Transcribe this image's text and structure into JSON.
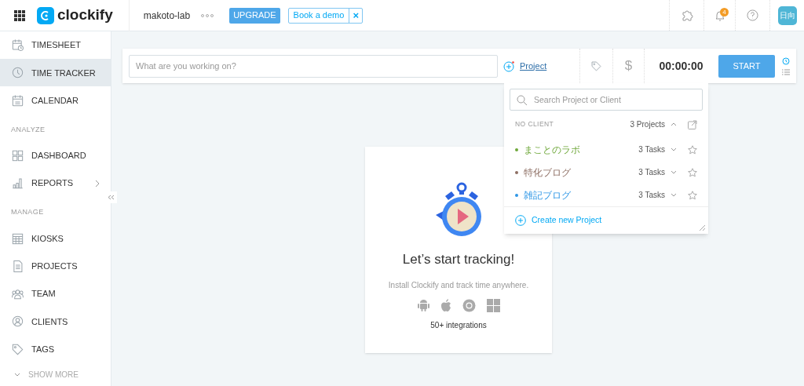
{
  "topbar": {
    "logo": "clockify",
    "workspace": "makoto-lab",
    "upgrade": "UPGRADE",
    "demo": "Book a demo",
    "demo_close": "×",
    "notifications": "4",
    "avatar": "日向"
  },
  "sidebar": {
    "items": [
      {
        "kind": "item",
        "label": "TIMESHEET",
        "selected": false,
        "expandable": false
      },
      {
        "kind": "item",
        "label": "TIME TRACKER",
        "selected": true,
        "expandable": false
      },
      {
        "kind": "item",
        "label": "CALENDAR",
        "selected": false,
        "expandable": false
      },
      {
        "kind": "section",
        "label": "ANALYZE"
      },
      {
        "kind": "item",
        "label": "DASHBOARD",
        "selected": false,
        "expandable": false
      },
      {
        "kind": "item",
        "label": "REPORTS",
        "selected": false,
        "expandable": true
      },
      {
        "kind": "section",
        "label": "MANAGE"
      },
      {
        "kind": "item",
        "label": "KIOSKS",
        "selected": false,
        "expandable": false
      },
      {
        "kind": "item",
        "label": "PROJECTS",
        "selected": false,
        "expandable": false
      },
      {
        "kind": "item",
        "label": "TEAM",
        "selected": false,
        "expandable": false
      },
      {
        "kind": "item",
        "label": "CLIENTS",
        "selected": false,
        "expandable": false
      },
      {
        "kind": "item",
        "label": "TAGS",
        "selected": false,
        "expandable": false
      }
    ],
    "show_more": "SHOW MORE"
  },
  "tracker": {
    "placeholder": "What are you working on?",
    "project": "Project",
    "currency": "$",
    "time": "00:00:00",
    "start": "START"
  },
  "project_dropdown": {
    "placeholder": "Search Project or Client",
    "group": "NO CLIENT",
    "group_count": "3 Projects",
    "expanded": true,
    "projects": [
      {
        "name": "まことのラボ",
        "tasks": "3 Tasks",
        "color": "#6fa83a"
      },
      {
        "name": "特化ブログ",
        "tasks": "3 Tasks",
        "color": "#8d6e63"
      },
      {
        "name": "雑記ブログ",
        "tasks": "3 Tasks",
        "color": "#2f97e6"
      }
    ],
    "create": "Create new Project"
  },
  "empty_state": {
    "title": "Let’s start tracking!",
    "subtitle": "Install Clockify and track time anywhere.",
    "integrations": "50+ integrations"
  }
}
